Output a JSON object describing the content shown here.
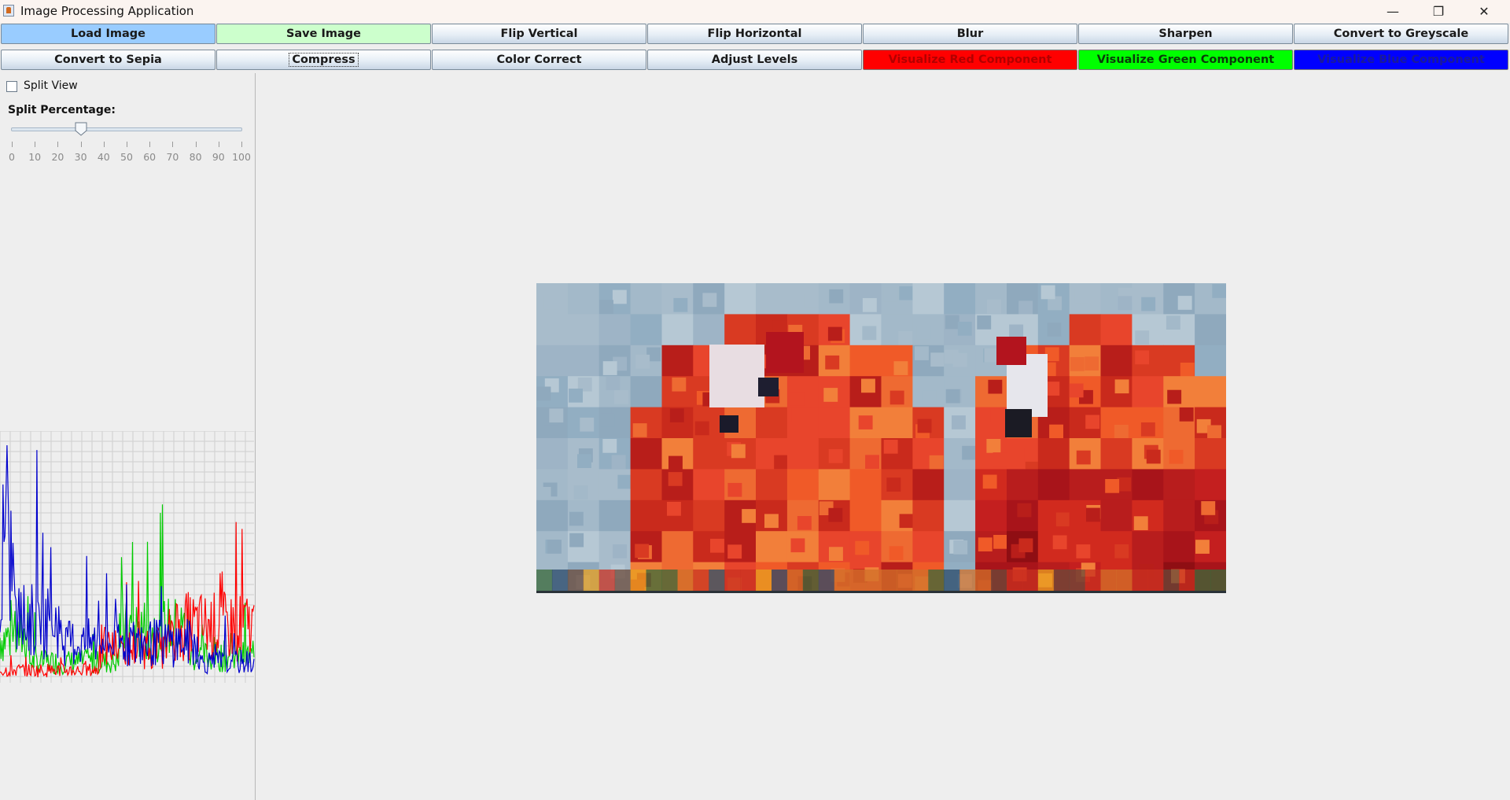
{
  "window": {
    "title": "Image Processing Application",
    "controls": {
      "minimize": "—",
      "maximize": "❐",
      "close": "✕"
    }
  },
  "toolbar": {
    "row1": [
      "Load Image",
      "Save Image",
      "Flip Vertical",
      "Flip Horizontal",
      "Blur",
      "Sharpen",
      "Convert to Greyscale"
    ],
    "row2": [
      "Convert to Sepia",
      "Compress",
      "Color Correct",
      "Adjust Levels",
      "Visualize Red Component",
      "Visualize Green Component",
      "Visualize Blue Component"
    ],
    "colors": {
      "load": "#99ccff",
      "save": "#ccffcc",
      "red": "#ff0000",
      "green": "#00ff00",
      "blue": "#0000ff"
    }
  },
  "left_panel": {
    "split_view_label": "Split View",
    "split_view_checked": false,
    "split_percentage_label": "Split Percentage:",
    "slider_value": 30,
    "slider_ticks": [
      "0",
      "10",
      "20",
      "30",
      "40",
      "50",
      "60",
      "70",
      "80",
      "90",
      "100"
    ]
  },
  "histogram": {
    "series_colors": {
      "red": "#ff0000",
      "green": "#00cc00",
      "blue": "#0000cc"
    },
    "grid": true
  },
  "image": {
    "description_icon": "pixelated-parrots-image"
  }
}
